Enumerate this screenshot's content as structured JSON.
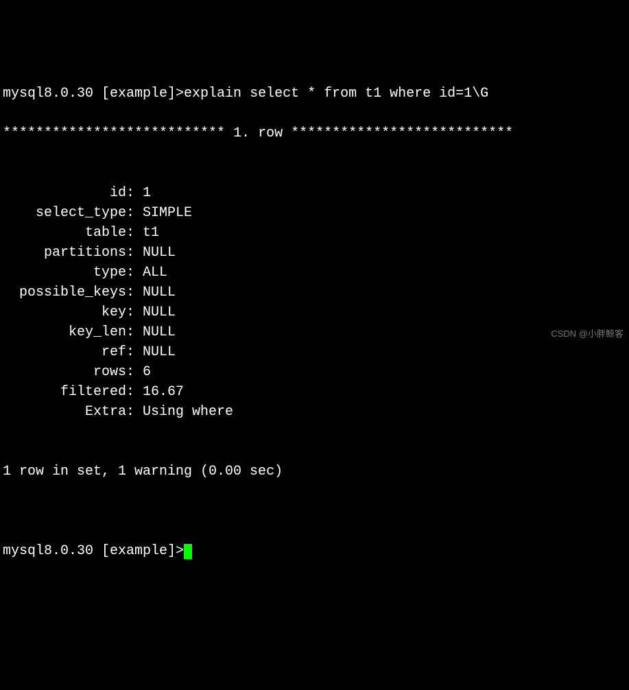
{
  "prompt": {
    "prefix": "mysql8.0.30 [example]>",
    "command": "explain select * from t1 where id=1\\G"
  },
  "separator": {
    "left": "***************************",
    "label": " 1. row ",
    "right": "***************************"
  },
  "rows": [
    {
      "key": "id",
      "value": "1"
    },
    {
      "key": "select_type",
      "value": "SIMPLE"
    },
    {
      "key": "table",
      "value": "t1"
    },
    {
      "key": "partitions",
      "value": "NULL"
    },
    {
      "key": "type",
      "value": "ALL"
    },
    {
      "key": "possible_keys",
      "value": "NULL"
    },
    {
      "key": "key",
      "value": "NULL"
    },
    {
      "key": "key_len",
      "value": "NULL"
    },
    {
      "key": "ref",
      "value": "NULL"
    },
    {
      "key": "rows",
      "value": "6"
    },
    {
      "key": "filtered",
      "value": "16.67"
    },
    {
      "key": "Extra",
      "value": "Using where"
    }
  ],
  "summary": "1 row in set, 1 warning (0.00 sec)",
  "prompt2": {
    "prefix": "mysql8.0.30 [example]>"
  },
  "watermark": "CSDN @小胖鲸客"
}
